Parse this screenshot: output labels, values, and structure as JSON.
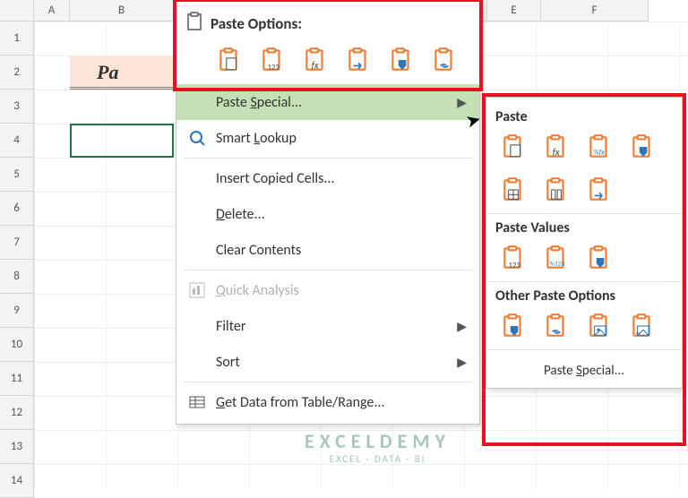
{
  "sheet": {
    "columns": [
      "A",
      "B",
      "E",
      "F"
    ],
    "rows": [
      "1",
      "2",
      "3",
      "4",
      "5",
      "6",
      "7",
      "8",
      "9",
      "10",
      "11",
      "12",
      "13",
      "14"
    ],
    "b2_value": "Pa"
  },
  "context_menu": {
    "paste_options_label": "Paste Options:",
    "top_icons": [
      "paste",
      "paste-values-123",
      "paste-formulas-fx",
      "paste-transpose",
      "paste-formatting",
      "paste-link"
    ],
    "items": [
      {
        "key": "paste_special",
        "label": "Paste Special...",
        "underline": "S",
        "icon": "",
        "arrow": true,
        "hover": true
      },
      {
        "key": "smart_lookup",
        "label": "Smart Lookup",
        "underline": "L",
        "icon": "lookup",
        "arrow": false
      },
      {
        "sep": true
      },
      {
        "key": "insert_copied",
        "label": "Insert Copied Cells...",
        "underline": "E",
        "icon": "",
        "arrow": false
      },
      {
        "key": "delete",
        "label": "Delete...",
        "underline": "D",
        "icon": "",
        "arrow": false
      },
      {
        "key": "clear",
        "label": "Clear Contents",
        "underline": "N",
        "icon": "",
        "arrow": false
      },
      {
        "sep": true
      },
      {
        "key": "quick_analysis",
        "label": "Quick Analysis",
        "underline": "Q",
        "icon": "quick",
        "arrow": false,
        "disabled": true
      },
      {
        "key": "filter",
        "label": "Filter",
        "underline": "E",
        "icon": "",
        "arrow": true
      },
      {
        "key": "sort",
        "label": "Sort",
        "underline": "O",
        "icon": "",
        "arrow": true
      },
      {
        "sep": true
      },
      {
        "key": "get_data",
        "label": "Get Data from Table/Range...",
        "underline": "G",
        "icon": "table",
        "arrow": false
      }
    ]
  },
  "submenu": {
    "section1": {
      "title": "Paste",
      "icons": [
        "paste",
        "paste-fx",
        "paste-pctfx",
        "paste-brush",
        "paste-borders",
        "paste-colwidth",
        "paste-transpose"
      ]
    },
    "section2": {
      "title": "Paste Values",
      "icons": [
        "values-123",
        "values-pct123",
        "values-brush"
      ]
    },
    "section3": {
      "title": "Other Paste Options",
      "icons": [
        "formatting",
        "link",
        "picture",
        "linked-picture"
      ]
    },
    "footer": "Paste Special..."
  },
  "watermark": {
    "line1": "EXCELDEMY",
    "line2": "EXCEL · DATA · BI"
  }
}
